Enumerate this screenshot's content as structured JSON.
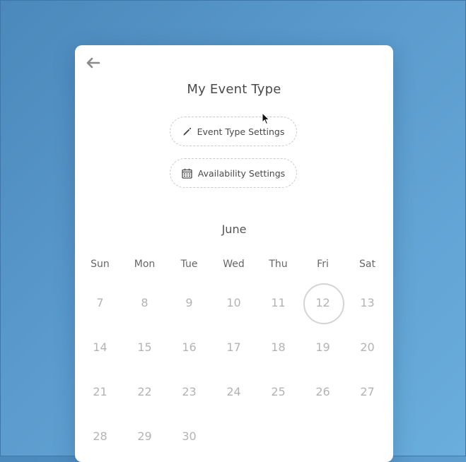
{
  "header": {
    "title": "My Event Type"
  },
  "buttons": {
    "event_type_settings": "Event Type Settings",
    "availability_settings": "Availability Settings"
  },
  "calendar": {
    "month": "June",
    "weekdays": [
      "Sun",
      "Mon",
      "Tue",
      "Wed",
      "Thu",
      "Fri",
      "Sat"
    ],
    "weeks": [
      [
        "7",
        "8",
        "9",
        "10",
        "11",
        "12",
        "13"
      ],
      [
        "14",
        "15",
        "16",
        "17",
        "18",
        "19",
        "20"
      ],
      [
        "21",
        "22",
        "23",
        "24",
        "25",
        "26",
        "27"
      ],
      [
        "28",
        "29",
        "30",
        "",
        "",
        "",
        ""
      ]
    ],
    "selected_day": "12"
  },
  "icons": {
    "back": "arrow-left-icon",
    "edit": "pencil-icon",
    "availability": "calendar-icon"
  },
  "colors": {
    "background_start": "#4b88bb",
    "background_end": "#6aaedd",
    "card": "#ffffff",
    "text": "#4a4a4a",
    "day_text": "#b3b3b3"
  }
}
